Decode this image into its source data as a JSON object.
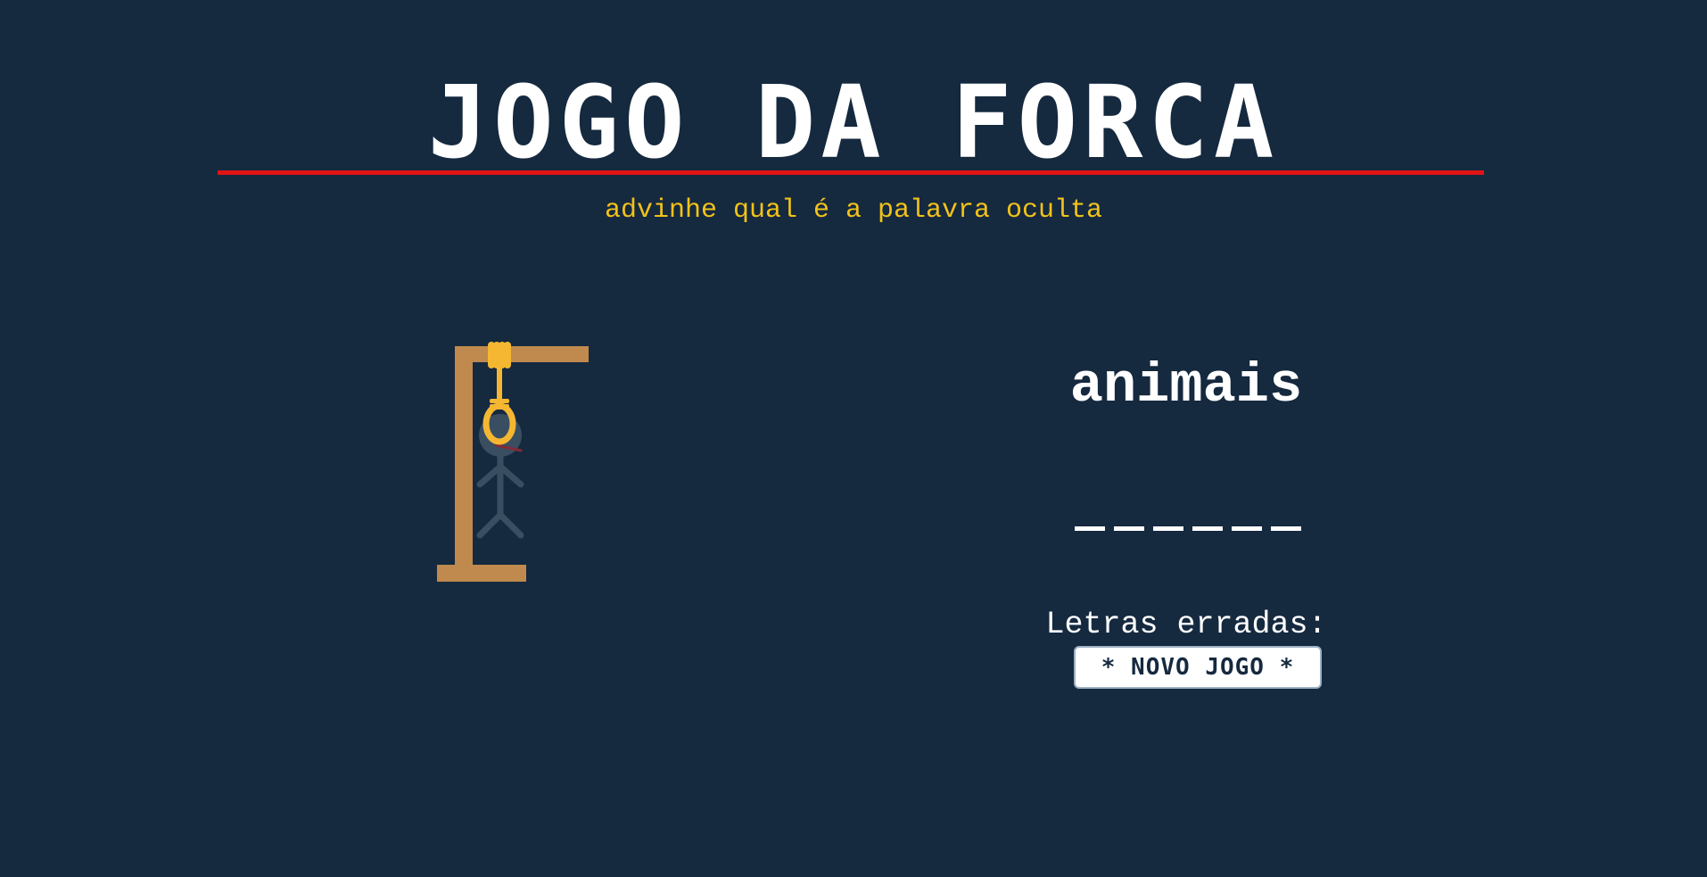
{
  "header": {
    "title": "JOGO DA FORCA",
    "subtitle": "advinhe qual é a palavra oculta"
  },
  "colors": {
    "background": "#15293f",
    "title": "#ffffff",
    "title_rule": "#e01414",
    "subtitle": "#f2c21a",
    "gallows": "#c0894e",
    "rope": "#f5b731",
    "figure": "#3c5164"
  },
  "game": {
    "category": "animais",
    "word_length": 6,
    "wrong_letters_label": "Letras erradas:",
    "wrong_letters": "",
    "new_game_button": "* NOVO JOGO *"
  },
  "icons": {
    "gallows": "gallows-icon",
    "noose": "noose-icon",
    "hangman_figure": "hangman-figure-icon"
  }
}
